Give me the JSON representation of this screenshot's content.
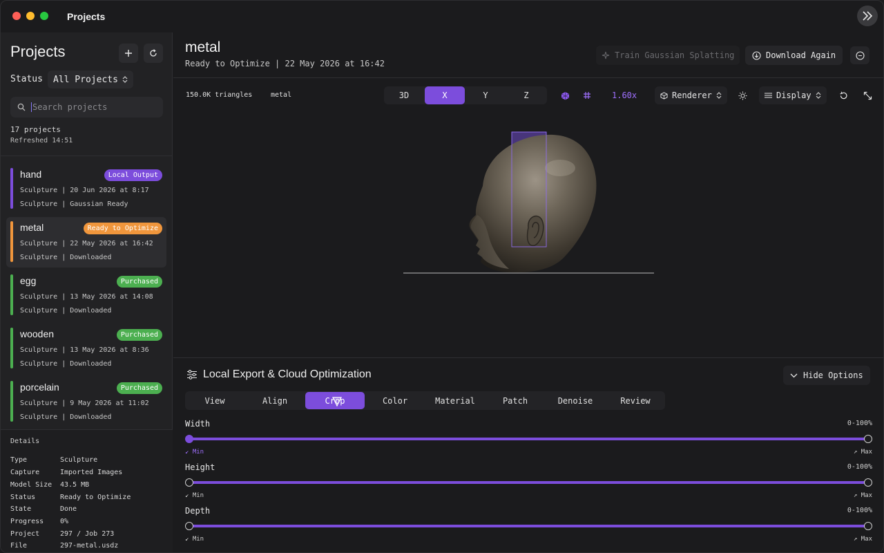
{
  "window": {
    "title": "Projects"
  },
  "sidebar": {
    "title": "Projects",
    "status_label": "Status",
    "status_value": "All Projects",
    "search_placeholder": "Search projects",
    "count": "17 projects",
    "refreshed": "Refreshed 14:51",
    "projects": [
      {
        "name": "hand",
        "badge": "Local Output",
        "badge_color": "#7c4ddc",
        "bar_color": "#7c4ddc",
        "line1": "Sculpture | 20 Jun 2026 at 8:17",
        "line2": "Sculpture | Gaussian Ready"
      },
      {
        "name": "metal",
        "badge": "Ready to Optimize",
        "badge_color": "#f0963c",
        "bar_color": "#f0963c",
        "line1": "Sculpture | 22 May 2026 at 16:42",
        "line2": "Sculpture | Downloaded"
      },
      {
        "name": "egg",
        "badge": "Purchased",
        "badge_color": "#4caf50",
        "bar_color": "#4caf50",
        "line1": "Sculpture | 13 May 2026 at 14:08",
        "line2": "Sculpture | Downloaded"
      },
      {
        "name": "wooden",
        "badge": "Purchased",
        "badge_color": "#4caf50",
        "bar_color": "#4caf50",
        "line1": "Sculpture | 13 May 2026 at 8:36",
        "line2": "Sculpture | Downloaded"
      },
      {
        "name": "porcelain",
        "badge": "Purchased",
        "badge_color": "#4caf50",
        "bar_color": "#4caf50",
        "line1": "Sculpture | 9 May 2026 at 11:02",
        "line2": "Sculpture | Downloaded"
      }
    ],
    "details": {
      "title": "Details",
      "rows": [
        {
          "k": "Type",
          "v": "Sculpture"
        },
        {
          "k": "Capture",
          "v": "Imported Images"
        },
        {
          "k": "Model Size",
          "v": "43.5 MB"
        },
        {
          "k": "Status",
          "v": "Ready to Optimize"
        },
        {
          "k": "State",
          "v": "Done"
        },
        {
          "k": "Progress",
          "v": "0%"
        },
        {
          "k": "Project",
          "v": "297 / Job 273"
        },
        {
          "k": "File",
          "v": "297-metal.usdz"
        }
      ]
    }
  },
  "main": {
    "title": "metal",
    "subtitle": "Ready to Optimize | 22 May 2026 at 16:42",
    "train_label": "Train Gaussian Splatting",
    "download_label": "Download Again",
    "toolbar": {
      "triangles": "150.0K triangles",
      "model_name": "metal",
      "views": [
        "3D",
        "X",
        "Y",
        "Z"
      ],
      "active_view": "X",
      "zoom": "1.60x",
      "renderer_label": "Renderer",
      "display_label": "Display"
    },
    "panel": {
      "title": "Local Export & Cloud Optimization",
      "hide_label": "Hide Options",
      "tabs": [
        "View",
        "Align",
        "Crop",
        "Color",
        "Material",
        "Patch",
        "Denoise",
        "Review"
      ],
      "active_tab": "Crop",
      "sliders": [
        {
          "label": "Width",
          "range": "0-100%",
          "min_label": "↙ Min",
          "max_label": "↗ Max",
          "value_min": 0,
          "value_max": 100,
          "accent": "#a070ff"
        },
        {
          "label": "Height",
          "range": "0-100%",
          "min_label": "↙ Min",
          "max_label": "↗ Max",
          "value_min": 0,
          "value_max": 100,
          "accent": "#cfcfcf"
        },
        {
          "label": "Depth",
          "range": "0-100%",
          "min_label": "↙ Min",
          "max_label": "↗ Max",
          "value_min": 0,
          "value_max": 100,
          "accent": "#cfcfcf"
        }
      ]
    }
  },
  "colors": {
    "accent": "#7c4ddc",
    "accent_text": "#a070ff",
    "background": "#1b1b1d"
  }
}
